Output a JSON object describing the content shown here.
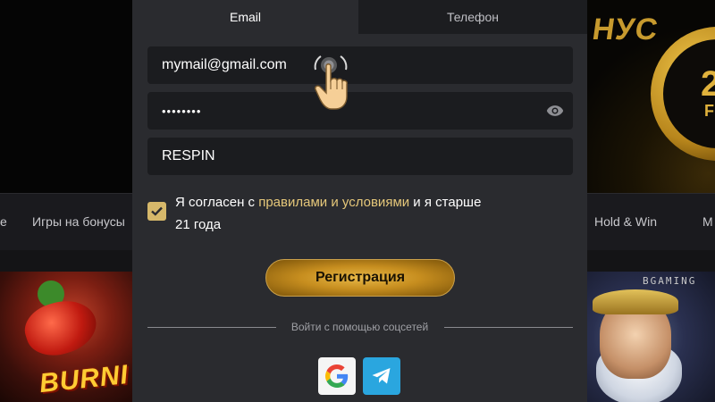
{
  "background": {
    "banner_right_text": "НУС",
    "coin_text_top": "2",
    "coin_text_bottom": "FR",
    "nav": {
      "items": [
        "е",
        "Игры на бонусы",
        "Hold & Win",
        "M"
      ]
    },
    "game_left_title": "BURNI",
    "game_right_provider": "BGAMING"
  },
  "modal": {
    "tabs": {
      "email_label": "Email",
      "phone_label": "Телефон",
      "active": "email"
    },
    "email_field": {
      "value": "mymail@gmail.com"
    },
    "password_field": {
      "value": "••••••••",
      "masked": true
    },
    "promo_field": {
      "value": "RESPIN"
    },
    "agreement": {
      "checked": true,
      "text_before": "Я согласен с ",
      "link_text": "правилами и условиями",
      "text_after": " и я старше 21 года"
    },
    "register_button_label": "Регистрация",
    "social_divider_text": "Войти с помощью соцсетей",
    "social_buttons": [
      "google-icon",
      "telegram-icon"
    ]
  },
  "colors": {
    "modal_bg": "#2a2b2f",
    "field_bg": "#1b1c1f",
    "accent_gold": "#e5c77a",
    "button_gold": "#c78e1f",
    "telegram_blue": "#2aa6df"
  }
}
